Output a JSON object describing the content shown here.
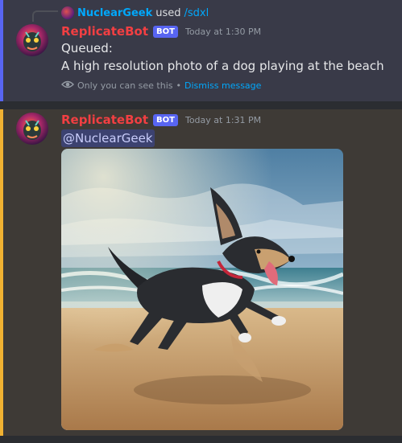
{
  "message1": {
    "reply": {
      "user": "NuclearGeek",
      "used": "used",
      "command": "/sdxl"
    },
    "author": "ReplicateBot",
    "badge": "BOT",
    "timestamp": "Today at 1:30 PM",
    "lines": [
      "Queued:",
      "A high resolution photo of a dog playing at the beach"
    ],
    "ephemeral": {
      "notice": "Only you can see this",
      "separator": "•",
      "dismiss": "Dismiss message"
    }
  },
  "message2": {
    "author": "ReplicateBot",
    "badge": "BOT",
    "timestamp": "Today at 1:31 PM",
    "mention": "@NuclearGeek"
  },
  "colors": {
    "bot_name": "#f23f42",
    "bot_badge": "#5865f2",
    "link": "#00a8fc",
    "ephemeral_bar": "#5865f2",
    "highlight_bar": "#f0b132"
  },
  "icons": [
    "eye-icon",
    "bot-avatar",
    "user-mini-avatar"
  ]
}
